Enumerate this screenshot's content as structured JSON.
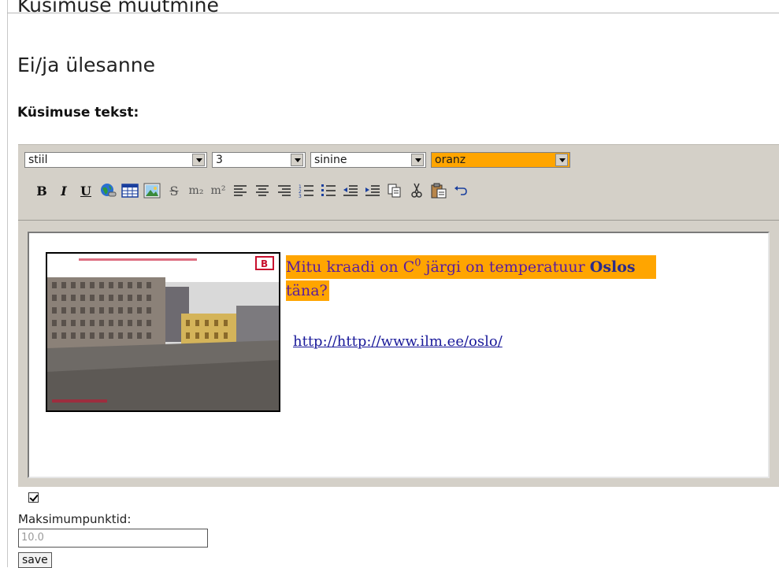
{
  "page": {
    "title": "Küsimuse muutmine",
    "subtitle": "Ei/ja ülesanne",
    "question_label": "Küsimuse tekst:"
  },
  "toolbar": {
    "style_select": "stiil",
    "size_select": "3",
    "color_select": "sinine",
    "bgcolor_select": "oranz",
    "buttons": {
      "bold": "B",
      "italic": "I",
      "underline": "U",
      "strike": "S",
      "subscript": "m₂",
      "superscript": "m²"
    }
  },
  "editor": {
    "question_part1": "Mitu kraadi on C",
    "question_sup": "0",
    "question_part2": " järgi on temperatuur ",
    "question_bold": "Oslos",
    "question_part3": "täna?",
    "link_text": "http://http://www.ilm.ee/oslo/"
  },
  "form": {
    "checkbox_checked": true,
    "max_points_label": "Maksimumpunktid:",
    "max_points_value": "10.0",
    "save_label": "save"
  },
  "colors": {
    "toolbar_bg": "#d4d0c8",
    "highlight": "#ffa500",
    "question_text": "#5a1c9e",
    "link": "#1a1a9a"
  }
}
